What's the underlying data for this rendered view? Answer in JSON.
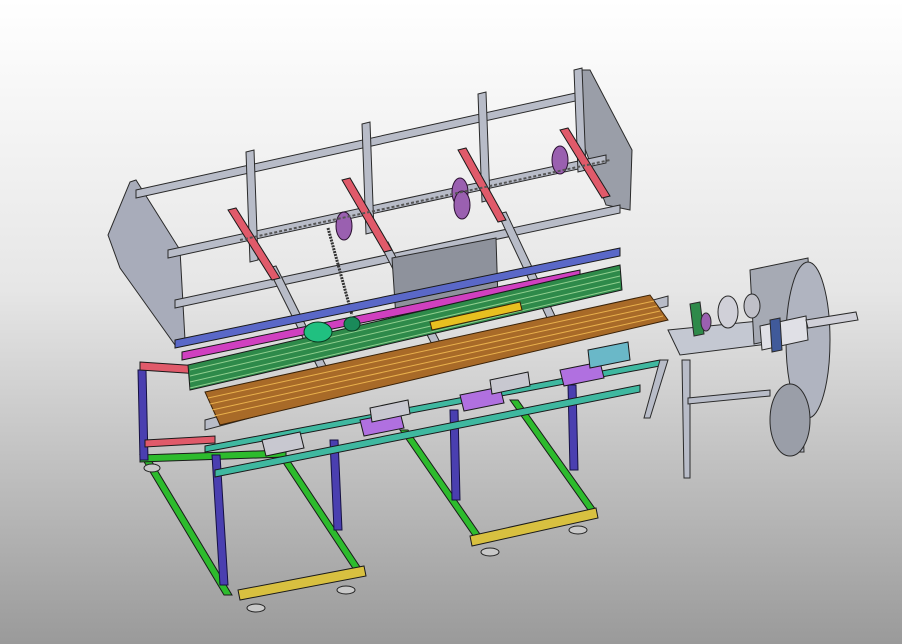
{
  "viewport": {
    "background_top": "#ffffff",
    "background_bottom": "#9a9a9a"
  },
  "colors": {
    "frame_gray": "#b8bcc8",
    "frame_edge": "#2a2a2a",
    "leg_blue": "#4a3fb0",
    "base_green": "#2dbb2d",
    "foot_yellow": "#d8c040",
    "rail_red": "#e05a6a",
    "rail_magenta": "#d040c0",
    "chain_green": "#2e8a4a",
    "rod_orange": "#c08030",
    "clamp_purple": "#b070e0",
    "motor_teal": "#20c080",
    "rail_teal": "#3fb8a0",
    "pulley_purple": "#9a60b0"
  },
  "parts": [
    {
      "name": "upper-frame",
      "icon": "gray-steel-tube-frame"
    },
    {
      "name": "side-plates",
      "icon": "gray-sheet-plate"
    },
    {
      "name": "lower-legs",
      "icon": "blue-steel-legs"
    },
    {
      "name": "base-frame",
      "icon": "green-steel-base"
    },
    {
      "name": "leveling-feet",
      "icon": "yellow-foot-bar"
    },
    {
      "name": "chain-conveyor",
      "icon": "green-chain"
    },
    {
      "name": "rod-feed-bed",
      "icon": "orange-rod-bundle"
    },
    {
      "name": "pneumatic-clamps",
      "icon": "purple-clamp"
    },
    {
      "name": "drive-motor",
      "icon": "teal-motor"
    },
    {
      "name": "cutting-unit",
      "icon": "gray-side-machine"
    }
  ]
}
